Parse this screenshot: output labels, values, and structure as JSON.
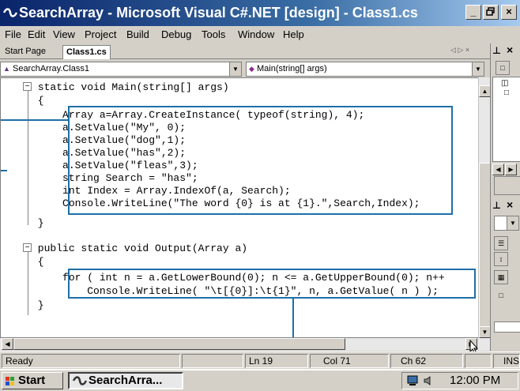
{
  "window": {
    "title": "SearchArray - Microsoft Visual C#.NET [design] - Class1.cs",
    "minimize_label": "_",
    "restore_label": " ",
    "close_label": "×"
  },
  "menu": [
    "File",
    "Edit",
    "View",
    "Project",
    "Build",
    "Debug",
    "Tools",
    "Window",
    "Help"
  ],
  "doc_tabs": [
    "Start Page",
    "Class1.cs"
  ],
  "doc_tab_controls": "◁ ▷ ×",
  "combos": {
    "class": "SearchArray.Class1",
    "member": "Main(string[] args)"
  },
  "code": [
    "      static void Main(string[] args)",
    "      {",
    "          Array a=Array.CreateInstance( typeof(string), 4);",
    "          a.SetValue(\"My\", 0);",
    "          a.SetValue(\"dog\",1);",
    "          a.SetValue(\"has\",2);",
    "          a.SetValue(\"fleas\",3);",
    "          string Search = \"has\";",
    "          int Index = Array.IndexOf(a, Search);",
    "          Console.WriteLine(\"The word {0} is at {1}.\",Search,Index);",
    "      }",
    "",
    "      public static void Output(Array a)",
    "      {",
    "          for ( int n = a.GetLowerBound(0); n <= a.GetUpperBound(0); n++",
    "              Console.WriteLine( \"\\t[{0}]:\\t{1}\", n, a.GetValue( n ) );",
    "      }"
  ],
  "status": {
    "ready": "Ready",
    "line": "Ln 19",
    "col": "Col 71",
    "ch": "Ch 62",
    "mode": "INS"
  },
  "taskbar": {
    "start": "Start",
    "task": "SearchArra...",
    "clock": "12:00 PM"
  },
  "colors": {
    "highlight_box": "#1e6fa8",
    "title_gradient_start": "#0a246a"
  },
  "icons": [
    "app-icon",
    "start-flag-icon",
    "taskbar-app-icon",
    "tray-computer-icon",
    "tray-sound-icon",
    "class-icon",
    "method-icon",
    "mouse-cursor-icon"
  ]
}
